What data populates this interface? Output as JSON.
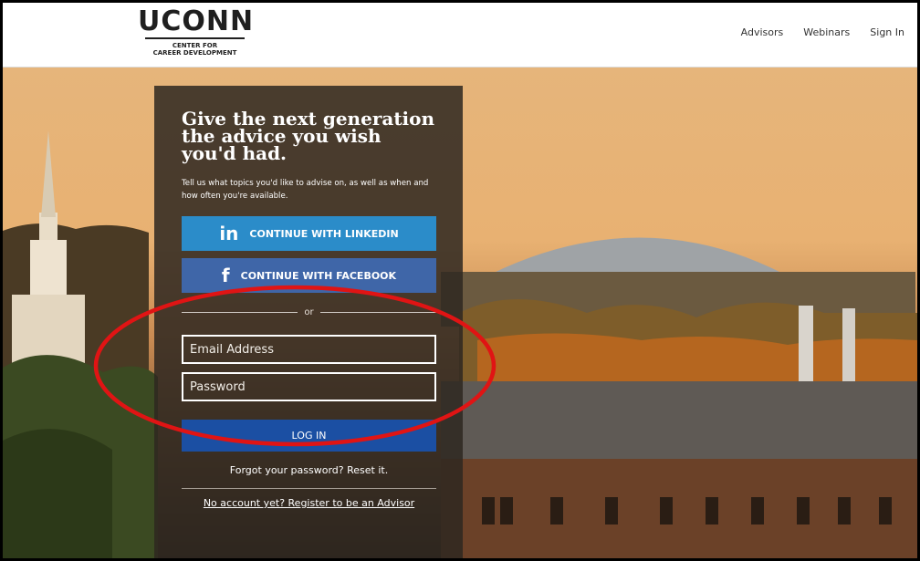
{
  "header": {
    "logo_main": "UCONN",
    "logo_sub_1": "CENTER FOR",
    "logo_sub_2": "CAREER DEVELOPMENT",
    "nav": [
      "Advisors",
      "Webinars",
      "Sign In"
    ]
  },
  "hero": {
    "headline": "Give the next generation the advice you wish you'd had.",
    "subtext": "Tell us what topics you'd like to advise on, as well as when and how often you're available."
  },
  "social": {
    "linkedin_label": "CONTINUE WITH LINKEDIN",
    "linkedin_icon": "linkedin-icon",
    "facebook_label": "CONTINUE WITH FACEBOOK",
    "facebook_icon": "facebook-icon"
  },
  "divider": {
    "text": "or"
  },
  "form": {
    "email_placeholder": "Email Address",
    "email_value": "",
    "password_placeholder": "Password",
    "password_value": "",
    "login_label": "LOG IN",
    "forgot_text": "Forgot your password? Reset it.",
    "register_text": "No account yet? Register to be an Advisor"
  },
  "colors": {
    "linkedin": "#2b8cc9",
    "facebook": "#3f66a8",
    "login": "#1b4fa3",
    "annotation": "#e01414",
    "panel": "#2f2821"
  }
}
